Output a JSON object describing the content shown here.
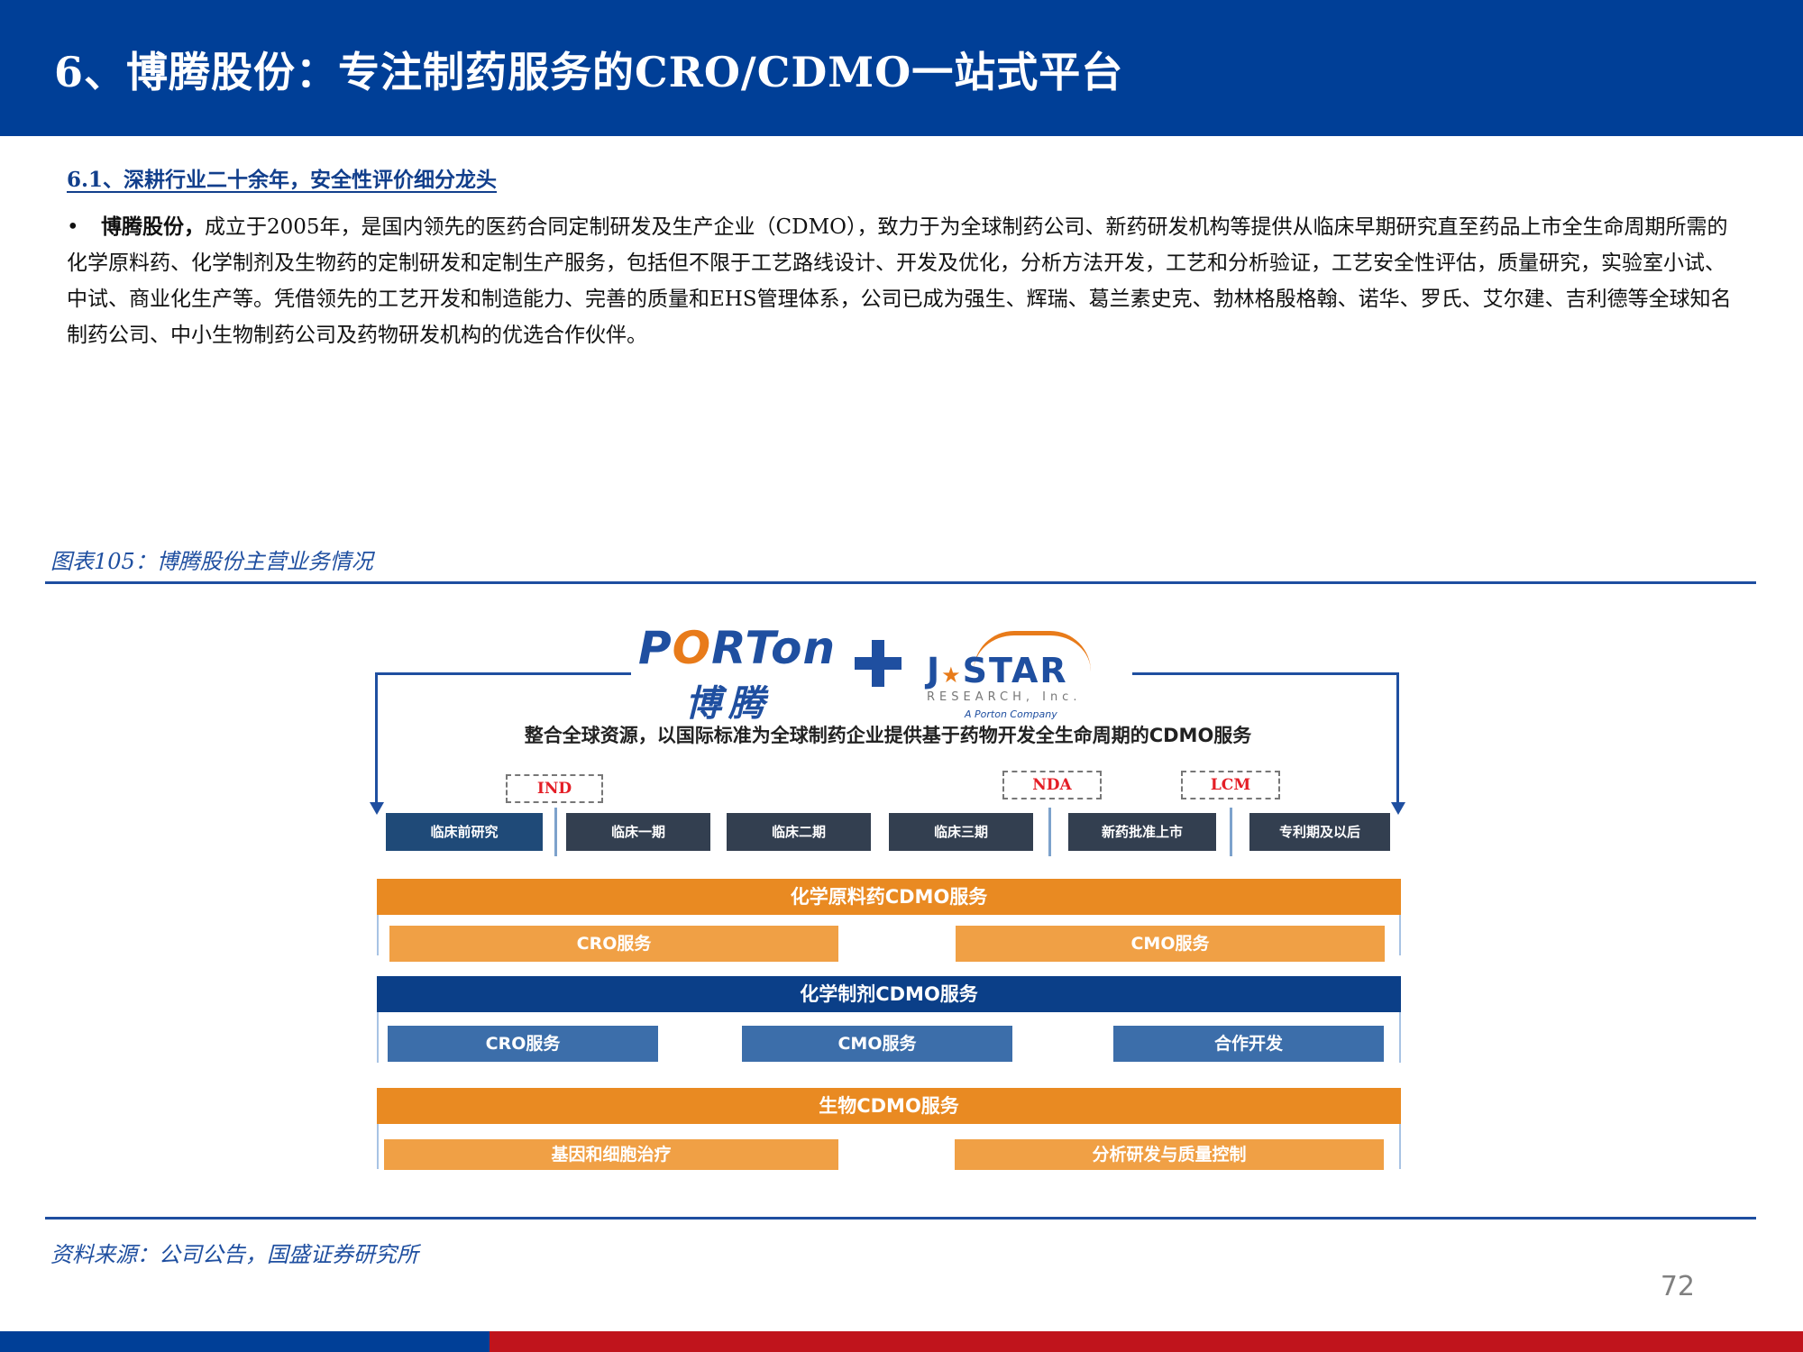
{
  "header": {
    "title": "6、博腾股份：专注制药服务的CRO/CDMO一站式平台"
  },
  "section": {
    "heading": "6.1、深耕行业二十余年，安全性评价细分龙头"
  },
  "body": {
    "bullet": "•",
    "lead": "博腾股份，",
    "text": "成立于2005年，是国内领先的医药合同定制研发及生产企业（CDMO），致力于为全球制药公司、新药研发机构等提供从临床早期研究直至药品上市全生命周期所需的化学原料药、化学制剂及生物药的定制研发和定制生产服务，包括但不限于工艺路线设计、开发及优化，分析方法开发，工艺和分析验证，工艺安全性评估，质量研究，实验室小试、中试、商业化生产等。凭借领先的工艺开发和制造能力、完善的质量和EHS管理体系，公司已成为强生、辉瑞、葛兰素史克、勃林格殷格翰、诺华、罗氏、艾尔建、吉利德等全球知名制药公司、中小生物制药公司及药物研发机构的优选合作伙伴。"
  },
  "figure": {
    "caption": "图表105：博腾股份主营业务情况",
    "logos": {
      "porton_pre": "P",
      "porton_o": "O",
      "porton_post": "RTon",
      "porton_cn": "博腾",
      "jstar_pre": "J",
      "jstar_star": "★",
      "jstar_post": "STAR",
      "jstar_sub": "RESEARCH, Inc.",
      "jstar_tag": "A Porton Company"
    },
    "title": "整合全球资源，以国际标准为全球制药企业提供基于药物开发全生命周期的CDMO服务",
    "milestones": [
      "IND",
      "NDA",
      "LCM"
    ],
    "stages": [
      "临床前研究",
      "临床一期",
      "临床二期",
      "临床三期",
      "新药批准上市",
      "专利期及以后"
    ],
    "groups": [
      {
        "title": "化学原料药CDMO服务",
        "items": [
          "CRO服务",
          "CMO服务"
        ]
      },
      {
        "title": "化学制剂CDMO服务",
        "items": [
          "CRO服务",
          "CMO服务",
          "合作开发"
        ]
      },
      {
        "title": "生物CDMO服务",
        "items": [
          "基因和细胞治疗",
          "分析研发与质量控制"
        ]
      }
    ],
    "colors": {
      "orange": "#e98a22",
      "navy": "#0b3f88",
      "stage": "#333f50",
      "milestone_text": "#e41e26"
    }
  },
  "source": "资料来源：公司公告，国盛证券研究所",
  "page_number": "72",
  "theme": {
    "header_blue": "#003f97",
    "footer_red": "#c0141c",
    "caption_blue": "#1f4fa0"
  }
}
